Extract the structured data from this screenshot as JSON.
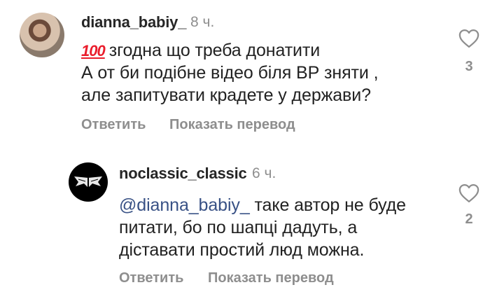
{
  "comments": [
    {
      "username": "dianna_babiy_",
      "time": "8 ч.",
      "emoji": "100",
      "line1": "згодна що треба донатити",
      "line2": "А от би подібне відео біля ВР зняти ,",
      "line3": "але запитувати крадете у держави?",
      "likes": "3",
      "reply_label": "Ответить",
      "translate_label": "Показать перевод"
    },
    {
      "username": "noclassic_classic",
      "time": "6 ч.",
      "mention": "@dianna_babiy_",
      "line1": " таке автор не буде",
      "line2": "питати, бо по шапці дадуть, а",
      "line3": "діставати простий люд можна.",
      "likes": "2",
      "reply_label": "Ответить",
      "translate_label": "Показать перевод"
    }
  ],
  "icons": {
    "heart": "heart-icon",
    "avatar2_logo": "moth-logo-icon"
  }
}
